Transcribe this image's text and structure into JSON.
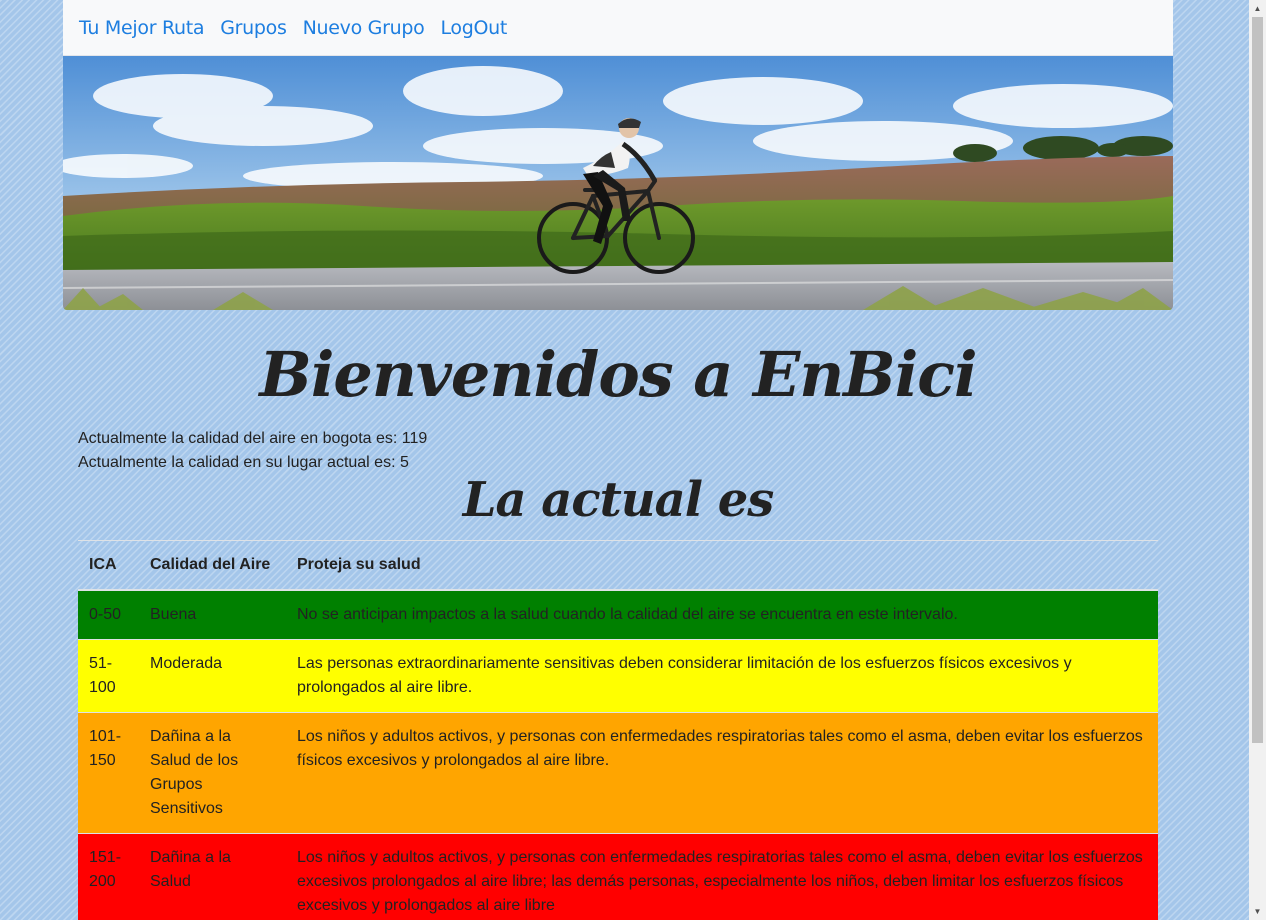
{
  "nav": {
    "items": [
      "Tu Mejor Ruta",
      "Grupos",
      "Nuevo Grupo",
      "LogOut"
    ]
  },
  "hero": {
    "image": "cyclist-on-road-banner"
  },
  "main_title": "Bienvenidos a EnBici",
  "info": {
    "line1": "Actualmente la calidad del aire en bogota es: 119",
    "line2": "Actualmente la calidad en su lugar actual es: 5"
  },
  "sub_title": "La actual es",
  "table": {
    "headers": [
      "ICA",
      "Calidad del Aire",
      "Proteja su salud"
    ],
    "rows": [
      {
        "ica": "0-50",
        "calidad": "Buena",
        "salud": "No se anticipan impactos a la salud cuando la calidad del aire se encuentra en este intervalo.",
        "color": "#008000"
      },
      {
        "ica": "51-100",
        "calidad": "Moderada",
        "salud": "Las personas extraordinariamente sensitivas deben considerar limitación de los esfuerzos físicos excesivos y prolongados al aire libre.",
        "color": "#ffff00"
      },
      {
        "ica": "101-150",
        "calidad": "Dañina a la Salud de los Grupos Sensitivos",
        "salud": "Los niños y adultos activos, y personas con enfermedades respiratorias tales como el asma, deben evitar los esfuerzos físicos excesivos y prolongados al aire libre.",
        "color": "#ffa500"
      },
      {
        "ica": "151-200",
        "calidad": "Dañina a la Salud",
        "salud": "Los niños y adultos activos, y personas con enfermedades respiratorias tales como el asma, deben evitar los esfuerzos excesivos prolongados al aire libre; las demás personas, especialmente los niños, deben limitar los esfuerzos físicos excesivos y prolongados al aire libre",
        "color": "#ff0000"
      }
    ]
  }
}
